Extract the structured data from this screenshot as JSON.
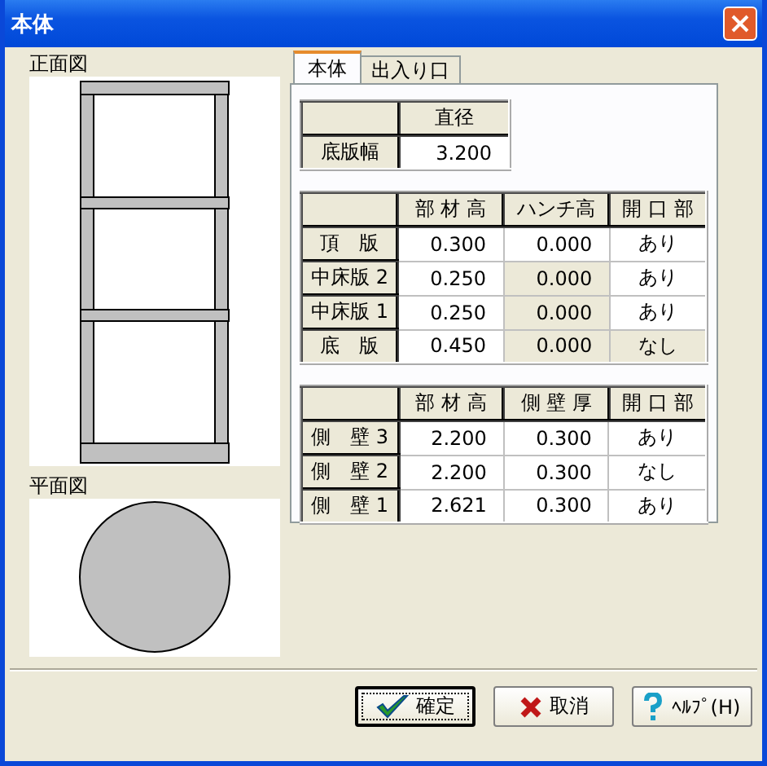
{
  "window": {
    "title": "本体"
  },
  "front_view": {
    "label": "正面図"
  },
  "plan_view": {
    "label": "平面図"
  },
  "tabs": [
    {
      "label": "本体",
      "selected": true
    },
    {
      "label": "出入り口",
      "selected": false
    }
  ],
  "base_table": {
    "columns": [
      "直径"
    ],
    "rows": [
      {
        "header": "底版幅",
        "cells": [
          {
            "text": "3.200",
            "disabled": false
          }
        ]
      }
    ]
  },
  "slab_table": {
    "columns": [
      "部 材 高",
      "ハンチ高",
      "開 口 部"
    ],
    "rows": [
      {
        "header": "頂　版",
        "cells": [
          {
            "text": "0.300",
            "disabled": false
          },
          {
            "text": "0.000",
            "disabled": false
          },
          {
            "text": "あり",
            "disabled": false
          }
        ]
      },
      {
        "header": "中床版 2",
        "cells": [
          {
            "text": "0.250",
            "disabled": false
          },
          {
            "text": "0.000",
            "disabled": true
          },
          {
            "text": "あり",
            "disabled": false
          }
        ]
      },
      {
        "header": "中床版 1",
        "cells": [
          {
            "text": "0.250",
            "disabled": false
          },
          {
            "text": "0.000",
            "disabled": true
          },
          {
            "text": "あり",
            "disabled": false
          }
        ]
      },
      {
        "header": "底　版",
        "cells": [
          {
            "text": "0.450",
            "disabled": false
          },
          {
            "text": "0.000",
            "disabled": true
          },
          {
            "text": "なし",
            "disabled": true
          }
        ]
      }
    ]
  },
  "wall_table": {
    "columns": [
      "部 材 高",
      "側 壁 厚",
      "開 口 部"
    ],
    "rows": [
      {
        "header": "側　壁 3",
        "cells": [
          {
            "text": "2.200",
            "disabled": false
          },
          {
            "text": "0.300",
            "disabled": false
          },
          {
            "text": "あり",
            "disabled": false
          }
        ]
      },
      {
        "header": "側　壁 2",
        "cells": [
          {
            "text": "2.200",
            "disabled": false
          },
          {
            "text": "0.300",
            "disabled": false
          },
          {
            "text": "なし",
            "disabled": false
          }
        ]
      },
      {
        "header": "側　壁 1",
        "cells": [
          {
            "text": "2.621",
            "disabled": false
          },
          {
            "text": "0.300",
            "disabled": false
          },
          {
            "text": "あり",
            "disabled": false
          }
        ]
      }
    ]
  },
  "buttons": [
    {
      "label": "確定",
      "kind": "ok",
      "focused": true
    },
    {
      "label": "取消",
      "kind": "cancel",
      "focused": false
    },
    {
      "label": "ﾍﾙﾌﾟ(H)",
      "kind": "help",
      "focused": false
    }
  ]
}
